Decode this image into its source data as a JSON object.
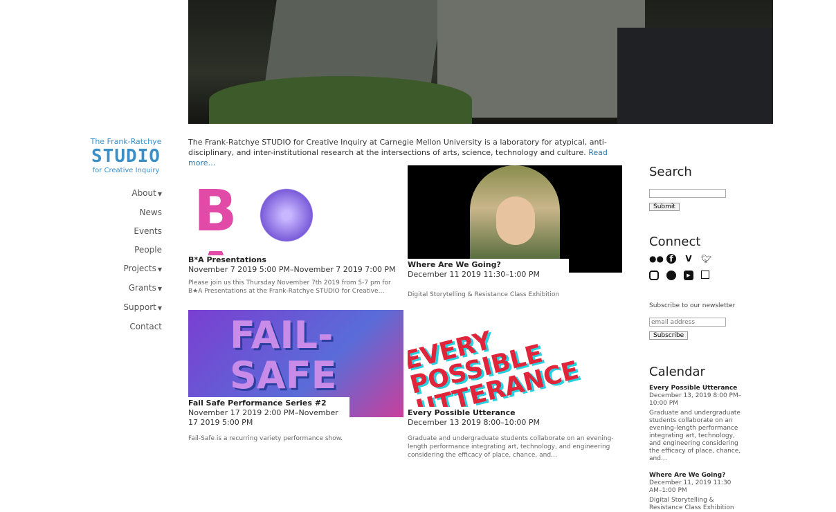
{
  "logo": {
    "line1": "The Frank-Ratchye",
    "line2": "STUDIO",
    "line3": "for Creative Inquiry"
  },
  "nav": [
    {
      "label": "About",
      "dropdown": true
    },
    {
      "label": "News",
      "dropdown": false
    },
    {
      "label": "Events",
      "dropdown": false
    },
    {
      "label": "People",
      "dropdown": false
    },
    {
      "label": "Projects",
      "dropdown": true
    },
    {
      "label": "Grants",
      "dropdown": true
    },
    {
      "label": "Support",
      "dropdown": true
    },
    {
      "label": "Contact",
      "dropdown": false
    }
  ],
  "intro": {
    "text": "The Frank-Ratchye STUDIO for Creative Inquiry at Carnegie Mellon University is a laboratory for atypical, anti-disciplinary, and inter-institutional research at the intersections of arts, science, technology and culture.",
    "read_more": "Read more…"
  },
  "events": [
    {
      "title": "B*A Presentations",
      "date": "November 7 2019 5:00 PM–November 7 2019 7:00 PM",
      "desc": "Please join us this Thursday November 7th 2019 from 5-7 pm for B★A Presentations at the Frank-Ratchye STUDIO for Creative…",
      "thumb_text": "B A"
    },
    {
      "title": "Where Are We Going?",
      "date": "December 11 2019 11:30–1:00 PM",
      "desc": "Digital Storytelling & Resistance Class Exhibition"
    },
    {
      "title": "Fail Safe Performance Series #2",
      "date": "November 17 2019 2:00 PM–November 17 2019 5:00 PM",
      "desc": "Fail-Safe is a recurring variety performance show.",
      "thumb_text": "FAIL-SAFE"
    },
    {
      "title": "Every Possible Utterance",
      "date": "December 13 2019 8:00–10:00 PM",
      "desc": "Graduate and undergraduate students collaborate on an evening-length performance integrating art, technology, and engineering considering the efficacy of place, chance, and…",
      "thumb_text": "EVERY POSSIBLE UTTERANCE"
    }
  ],
  "sidebar": {
    "search_title": "Search",
    "search_button": "Submit",
    "connect_title": "Connect",
    "social_icons": [
      "flickr-icon",
      "facebook-icon",
      "vimeo-icon",
      "twitter-icon",
      "instagram-icon",
      "github-icon",
      "youtube-icon",
      "calendar-icon"
    ],
    "newsletter_label": "Subscribe to our newsletter",
    "newsletter_placeholder": "email address",
    "subscribe_button": "Subscribe",
    "calendar_title": "Calendar",
    "calendar": [
      {
        "title": "Every Possible Utterance",
        "date": "December 13, 2019 8:00 PM–10:00 PM",
        "text": "Graduate and undergraduate students collaborate on an evening-length performance integrating art, technology, and engineering considering the efficacy of place, chance, and…"
      },
      {
        "title": "Where Are We Going?",
        "date": "December 11, 2019 11:30 AM–1:00 PM",
        "text": "Digital Storytelling & Resistance Class Exhibition"
      }
    ]
  },
  "colors": {
    "link": "#2a7ab0",
    "logo": "#3a8fc7"
  }
}
